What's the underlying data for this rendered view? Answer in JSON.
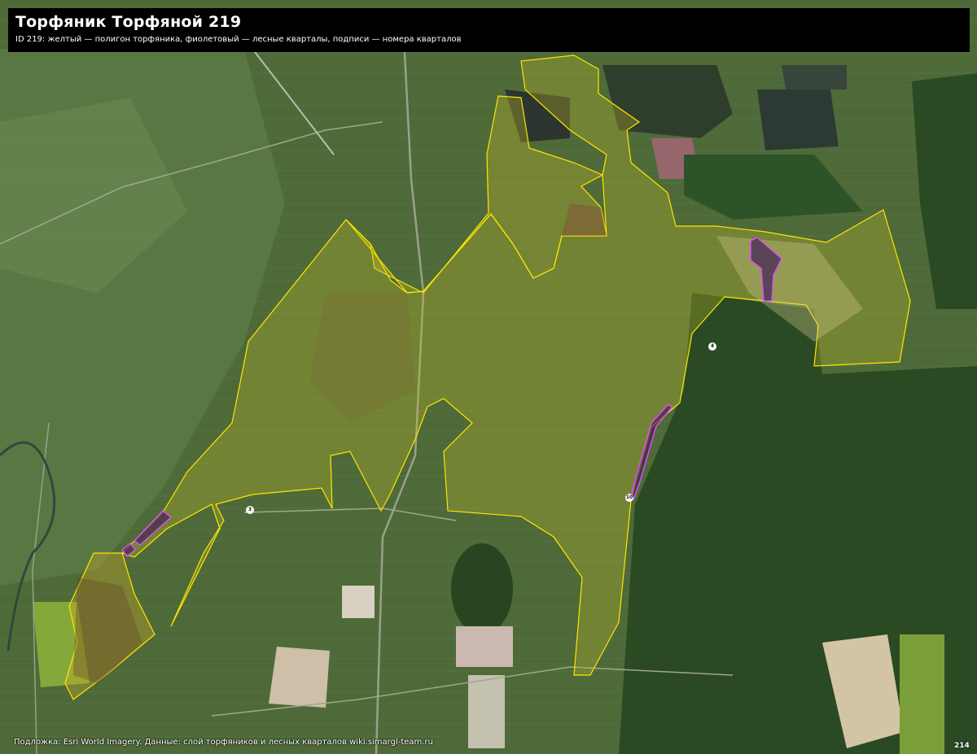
{
  "header": {
    "title": "Торфяник Торфяной 219",
    "subtitle": "ID 219: желтый — полигон торфяника, фиолетовый — лесные кварталы, подписи — номера кварталов"
  },
  "attribution": "Подложка: Esri World Imagery. Данные: слой торфяников и лесных кварталов wiki.simargl-team.ru",
  "corner_label": "214",
  "quarters": [
    {
      "id": "q3",
      "label": "3"
    },
    {
      "id": "q4",
      "label": "4"
    },
    {
      "id": "q10",
      "label": "10"
    }
  ],
  "colors": {
    "peat_outline": "#ffe600",
    "peat_fill": "rgba(200,190,40,0.35)",
    "forest_outline": "#e64dff",
    "forest_fill": "rgba(60,20,90,0.6)",
    "title_bg": "#000000"
  },
  "layers": {
    "peat_polygon": "желтый",
    "forest_quarters": "фиолетовый",
    "labels": "номера кварталов"
  }
}
